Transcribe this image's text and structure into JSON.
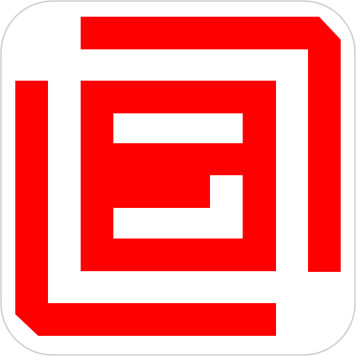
{
  "app_icon": {
    "name": "red-geometric-spiral-logo",
    "colors": {
      "background": "#ffffff",
      "border": "#cccccc",
      "mark": "#ff0000"
    }
  }
}
